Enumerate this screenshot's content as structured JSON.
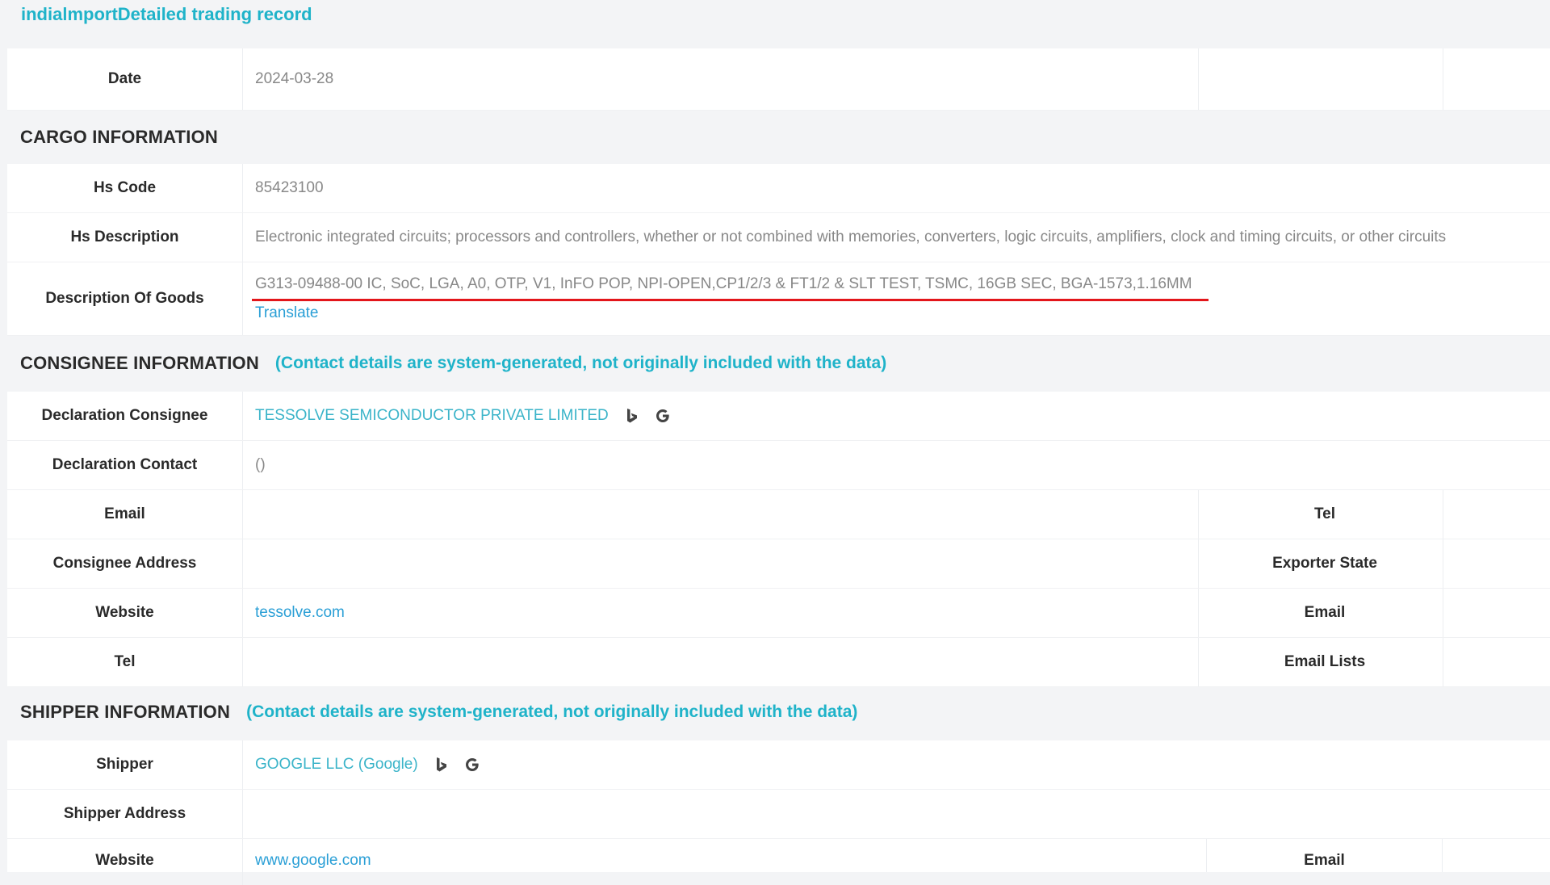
{
  "page_title": "indialmportDetailed trading record",
  "top": {
    "date_label": "Date",
    "date_value": "2024-03-28"
  },
  "cargo": {
    "title": "CARGO INFORMATION",
    "hs_code_label": "Hs Code",
    "hs_code_value": "85423100",
    "hs_desc_label": "Hs Description",
    "hs_desc_value": "Electronic integrated circuits; processors and controllers, whether or not combined with memories, converters, logic circuits, amplifiers, clock and timing circuits, or other circuits",
    "goods_label": "Description Of Goods",
    "goods_value": "G313-09488-00 IC, SoC, LGA, A0, OTP, V1, InFO POP, NPI-OPEN,CP1/2/3 & FT1/2 & SLT TEST, TSMC, 16GB SEC, BGA-1573,1.16MM",
    "translate_label": "Translate"
  },
  "consignee": {
    "title": "CONSIGNEE INFORMATION",
    "note": "(Contact details are system-generated, not originally included with the data)",
    "declaration_consignee_label": "Declaration Consignee",
    "declaration_consignee_value": "TESSOLVE SEMICONDUCTOR PRIVATE LIMITED",
    "declaration_contact_label": "Declaration Contact",
    "declaration_contact_value": "()",
    "email_label": "Email",
    "email_value": "",
    "tel_label_right": "Tel",
    "address_label": "Consignee Address",
    "address_value": "",
    "exporter_state_label": "Exporter State",
    "website_label": "Website",
    "website_value": "tessolve.com",
    "email_label_right": "Email",
    "tel_label": "Tel",
    "tel_value": "",
    "email_lists_label": "Email Lists"
  },
  "shipper": {
    "title": "SHIPPER INFORMATION",
    "note": "(Contact details are system-generated, not originally included with the data)",
    "shipper_label": "Shipper",
    "shipper_value": "GOOGLE LLC (Google)",
    "address_label": "Shipper Address",
    "address_value": "",
    "website_label": "Website",
    "website_value": "www.google.com",
    "email_label_right": "Email"
  },
  "icons": [
    "bing-icon",
    "google-icon"
  ],
  "colors": {
    "accent": "#1fb3c9",
    "link": "#2a9fd6",
    "underline": "#e3161b",
    "background": "#f3f4f6"
  }
}
